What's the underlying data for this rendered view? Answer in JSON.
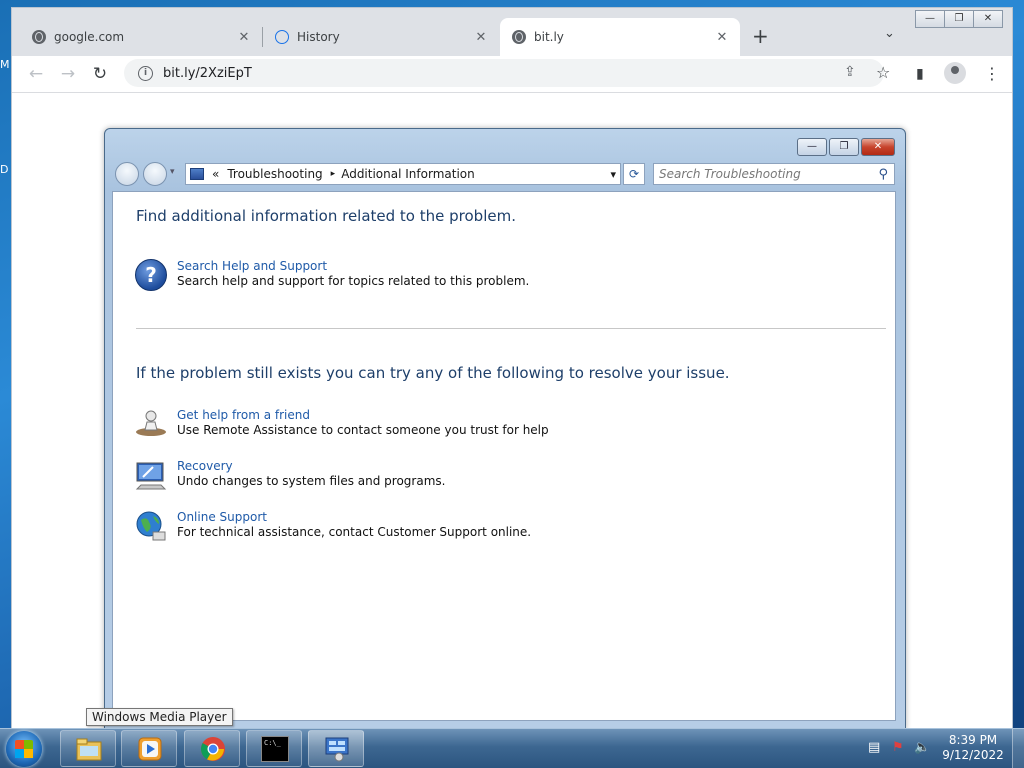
{
  "desktop": {
    "edge_chars": [
      "M",
      "D"
    ]
  },
  "browser": {
    "tabs": [
      {
        "title": "google.com",
        "close": "✕",
        "active": false
      },
      {
        "title": "History",
        "close": "✕",
        "active": false
      },
      {
        "title": "bit.ly",
        "close": "✕",
        "active": true
      }
    ],
    "new_tab": "+",
    "tab_list": "⌄",
    "window_buttons": [
      "—",
      "❐",
      "✕"
    ],
    "nav": {
      "back": "←",
      "forward": "→",
      "reload": "↻"
    },
    "url": "bit.ly/2XziEpT",
    "icons": {
      "share": "⇪",
      "bookmark": "☆",
      "side_panel": "▮",
      "menu": "⋮"
    }
  },
  "troubleshooting": {
    "window_buttons": [
      "—",
      "❐",
      "✕"
    ],
    "breadcrumb": {
      "chevron": "«",
      "items": [
        "Troubleshooting",
        "Additional Information"
      ],
      "separator": "▸",
      "dropdown": "▾"
    },
    "refresh": "⟳",
    "search_placeholder": "Search Troubleshooting",
    "search_glyph": "⚲",
    "heading1": "Find additional information related to the problem.",
    "help_task": {
      "link": "Search Help and Support",
      "desc": "Search help and support for topics related to this problem.",
      "glyph": "?"
    },
    "heading2": "If the problem still exists you can try any of the following to resolve your issue.",
    "tasks": [
      {
        "link": "Get help from a friend",
        "desc": "Use Remote Assistance to contact someone you trust for help",
        "icon": "remote-assistance-icon"
      },
      {
        "link": "Recovery",
        "desc": "Undo changes to system files and programs.",
        "icon": "recovery-icon"
      },
      {
        "link": "Online Support",
        "desc": "For technical assistance, contact Customer Support online.",
        "icon": "globe-icon"
      }
    ]
  },
  "tooltip": "Windows Media Player",
  "taskbar": {
    "items": [
      "explorer-icon",
      "media-player-icon",
      "chrome-icon",
      "cmd-icon",
      "control-panel-icon"
    ],
    "cmd_text": "C:\\_",
    "tray_icons": {
      "network": "▤",
      "flag": "⚑",
      "volume": "🔈"
    },
    "time": "8:39 PM",
    "date": "9/12/2022"
  }
}
